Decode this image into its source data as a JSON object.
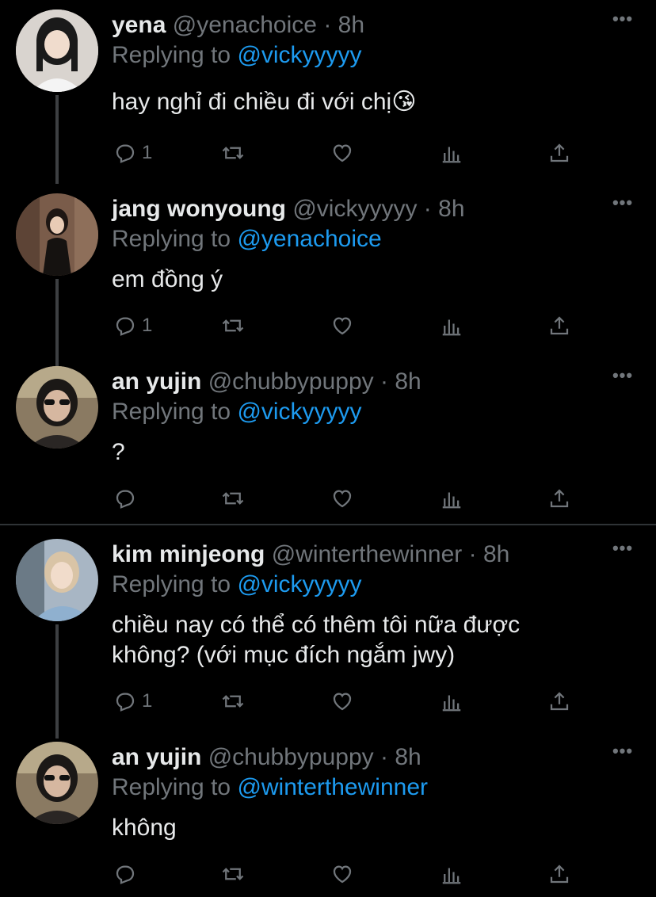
{
  "tweets": [
    {
      "name": "yena",
      "handle": "@yenachoice",
      "dot": "·",
      "time": "8h",
      "reply_prefix": "Replying to",
      "reply_to": "@vickyyyyy",
      "text": "hay nghỉ đi chiều đi với chị😘",
      "reply_count": "1",
      "avatar_color": "#d9d4cf"
    },
    {
      "name": "jang wonyoung",
      "handle": "@vickyyyyy",
      "dot": "·",
      "time": "8h",
      "reply_prefix": "Replying to",
      "reply_to": "@yenachoice",
      "text": "em đồng ý",
      "reply_count": "1",
      "avatar_color": "#7a5c4a"
    },
    {
      "name": "an yujin",
      "handle": "@chubbypuppy",
      "dot": "·",
      "time": "8h",
      "reply_prefix": "Replying to",
      "reply_to": "@vickyyyyy",
      "text": "?",
      "reply_count": "",
      "avatar_color": "#8a7a62"
    },
    {
      "name": "kim minjeong",
      "handle": "@winterthewinner",
      "dot": "·",
      "time": "8h",
      "reply_prefix": "Replying to",
      "reply_to": "@vickyyyyy",
      "text": "chiều nay có thể có thêm tôi nữa được không? (với mục đích ngắm jwy)",
      "reply_count": "1",
      "avatar_color": "#a8b6c4"
    },
    {
      "name": "an yujin",
      "handle": "@chubbypuppy",
      "dot": "·",
      "time": "8h",
      "reply_prefix": "Replying to",
      "reply_to": "@winterthewinner",
      "text": "không",
      "reply_count": "",
      "avatar_color": "#8a7a62"
    }
  ],
  "more_glyph": "•••",
  "colors": {
    "background": "#000000",
    "text": "#e7e9ea",
    "muted": "#71767b",
    "link": "#1d9bf0",
    "thread_line": "#3d3f42",
    "separator": "#2f3336"
  },
  "icons": [
    "reply-icon",
    "retweet-icon",
    "like-icon",
    "analytics-icon",
    "share-icon",
    "more-icon"
  ]
}
